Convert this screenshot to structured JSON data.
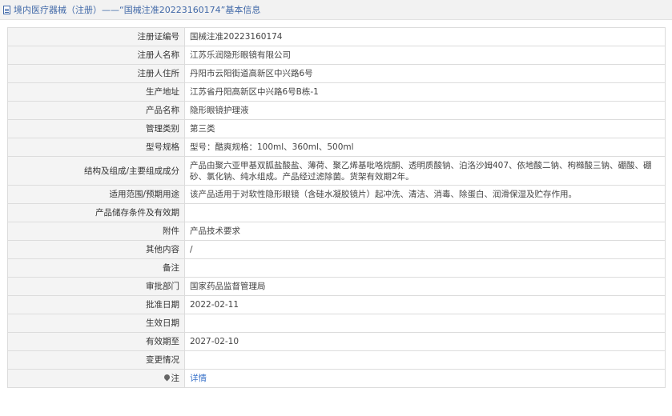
{
  "header": {
    "title": "境内医疗器械（注册）——“国械注准20223160174”基本信息"
  },
  "rows": [
    {
      "label": "注册证编号",
      "value": "国械注准20223160174"
    },
    {
      "label": "注册人名称",
      "value": "江苏乐润隐形眼镜有限公司"
    },
    {
      "label": "注册人住所",
      "value": "丹阳市云阳街道高新区中兴路6号"
    },
    {
      "label": "生产地址",
      "value": "江苏省丹阳高新区中兴路6号B栋-1"
    },
    {
      "label": "产品名称",
      "value": "隐形眼镜护理液"
    },
    {
      "label": "管理类别",
      "value": "第三类"
    },
    {
      "label": "型号规格",
      "value": "型号：酷爽规格：100ml、360ml、500ml"
    },
    {
      "label": "结构及组成/主要组成成分",
      "value": "产品由聚六亚甲基双胍盐酸盐、薄荷、聚乙烯基吡咯烷酮、透明质酸钠、泊洛沙姆407、依地酸二钠、枸橼酸三钠、硼酸、硼砂、氯化钠、纯水组成。产品经过滤除菌。货架有效期2年。"
    },
    {
      "label": "适用范围/预期用途",
      "value": "该产品适用于对软性隐形眼镜（含硅水凝胶镜片）起冲洗、清洁、消毒、除蛋白、润滑保湿及贮存作用。"
    },
    {
      "label": "产品储存条件及有效期",
      "value": ""
    },
    {
      "label": "附件",
      "value": "产品技术要求"
    },
    {
      "label": "其他内容",
      "value": "/"
    },
    {
      "label": "备注",
      "value": ""
    },
    {
      "label": "审批部门",
      "value": "国家药品监督管理局"
    },
    {
      "label": "批准日期",
      "value": "2022-02-11"
    },
    {
      "label": "生效日期",
      "value": ""
    },
    {
      "label": "有效期至",
      "value": "2027-02-10"
    },
    {
      "label": "变更情况",
      "value": ""
    },
    {
      "label": "注",
      "value": "详情"
    }
  ]
}
